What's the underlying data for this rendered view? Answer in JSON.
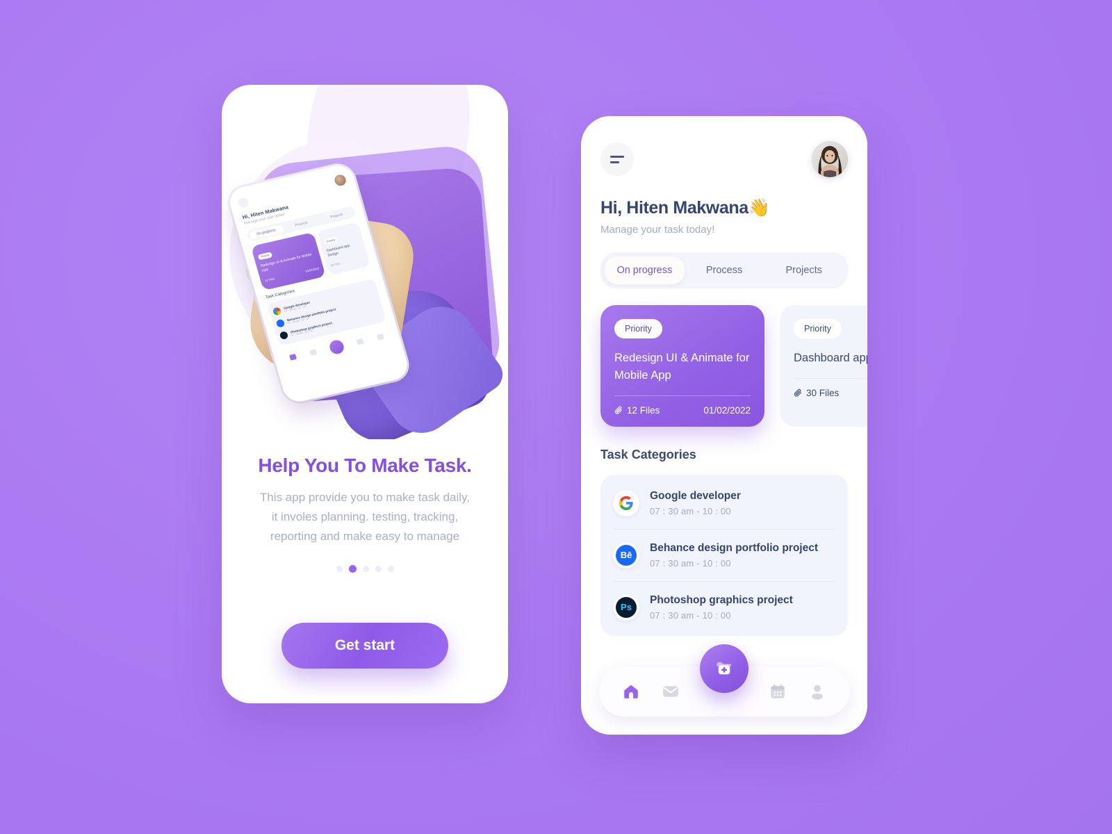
{
  "theme": {
    "background": "#AC7BF2",
    "accent": "#8450E0",
    "accent_light": "#A778EC",
    "text_dark": "#35456F",
    "text_muted": "#A4ABC4",
    "panel_bg": "#F1F4FC"
  },
  "onboarding": {
    "headline": "Help You To Make Task.",
    "subcopy": "This app provide you to make task daily, it involes planning. testing, tracking, reporting and make easy to manage",
    "subcopy_lines": [
      "This app provide you to make task daily,",
      "it involes planning. testing, tracking,",
      "reporting and make easy to manage"
    ],
    "pagination": {
      "total": 5,
      "active_index": 1
    },
    "cta_label": "Get start",
    "illustration": {
      "icon_name": "3d-hand-holding-phone",
      "mini_preview": {
        "greeting": "Hi, Hiten Makwana",
        "subtitle": "Manage your task today!",
        "tabs": [
          "On progress",
          "Process",
          "Projects"
        ],
        "active_tab": "On progress",
        "card_primary": {
          "pill": "Priority",
          "title": "Redesign UI & Animate for Mobile App",
          "files": "12 Files",
          "date": "01/02/2022"
        },
        "card_secondary": {
          "pill": "Priority",
          "title": "Dashboard app Design",
          "files": "30 Files"
        },
        "section_title": "Task Categories",
        "categories": [
          {
            "name": "Google developer",
            "time": "07 : 30 am - 10 : 00"
          },
          {
            "name": "Behance design portfolio project",
            "time": "07 : 30 am - 10 : 00"
          },
          {
            "name": "Photoshop graphics project",
            "time": "07 : 30 am - 10 : 00"
          }
        ]
      }
    }
  },
  "dashboard": {
    "menu_icon": "hamburger-menu-icon",
    "avatar_icon": "user-avatar-photo",
    "greeting": "Hi, Hiten Makwana👋",
    "subtitle": "Manage your task today!",
    "tabs": [
      {
        "label": "On progress",
        "active": true
      },
      {
        "label": "Process",
        "active": false
      },
      {
        "label": "Projects",
        "active": false
      }
    ],
    "task_cards": [
      {
        "priority_label": "Priority",
        "title": "Redesign UI & Animate for Mobile App",
        "files": "12 Files",
        "date": "01/02/2022",
        "style": "primary"
      },
      {
        "priority_label": "Priority",
        "title": "Dashboard app Design",
        "files": "30 Files",
        "date": "",
        "style": "plain"
      }
    ],
    "section_title": "Task Categories",
    "categories": [
      {
        "icon": "google-logo-icon",
        "name": "Google developer",
        "time": "07 : 30 am - 10 : 00"
      },
      {
        "icon": "behance-logo-icon",
        "glyph": "Bē",
        "name": "Behance design portfolio project",
        "time": "07 : 30 am - 10 : 00"
      },
      {
        "icon": "photoshop-logo-icon",
        "glyph": "Ps",
        "name": "Photoshop graphics project",
        "time": "07 : 30 am - 10 : 00"
      }
    ],
    "bottom_nav": [
      {
        "icon": "home-icon",
        "active": true
      },
      {
        "icon": "mail-icon",
        "active": false
      },
      {
        "icon": "add-folder-fab-icon",
        "active": false,
        "is_fab": true
      },
      {
        "icon": "calendar-icon",
        "active": false
      },
      {
        "icon": "profile-icon",
        "active": false
      }
    ]
  }
}
